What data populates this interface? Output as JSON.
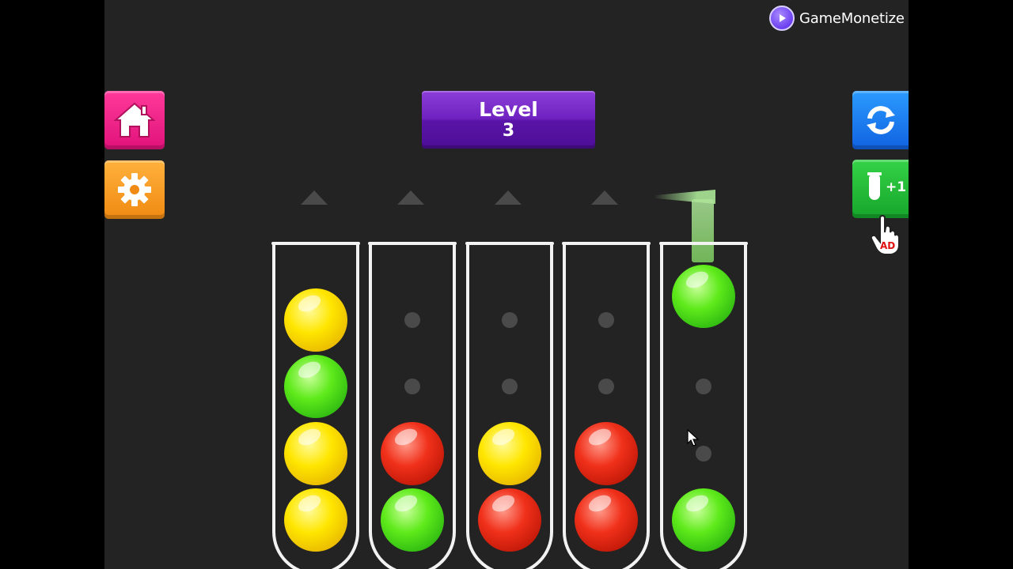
{
  "brand": {
    "name": "GameMonetize"
  },
  "level": {
    "title": "Level",
    "number": "3"
  },
  "buttons": {
    "home": {
      "icon": "home-icon",
      "color": "#e8207f"
    },
    "settings": {
      "icon": "gear-icon",
      "color": "#f5951c"
    },
    "restart": {
      "icon": "refresh-icon",
      "color": "#1b7cf0"
    },
    "add_tube": {
      "icon": "tube-icon",
      "label": "+1",
      "badge": "AD",
      "color": "#22b935"
    }
  },
  "tubes": [
    {
      "balls": [
        "yellow",
        "green",
        "yellow",
        "yellow"
      ]
    },
    {
      "balls": [
        "red",
        "green"
      ]
    },
    {
      "balls": [
        "yellow",
        "red"
      ]
    },
    {
      "balls": [
        "red",
        "red"
      ]
    },
    {
      "balls": [
        "green"
      ],
      "lifted": "green"
    }
  ],
  "colors": {
    "yellow": "#ffe600",
    "green": "#4cd61a",
    "red": "#e02a12",
    "background": "#232323"
  }
}
